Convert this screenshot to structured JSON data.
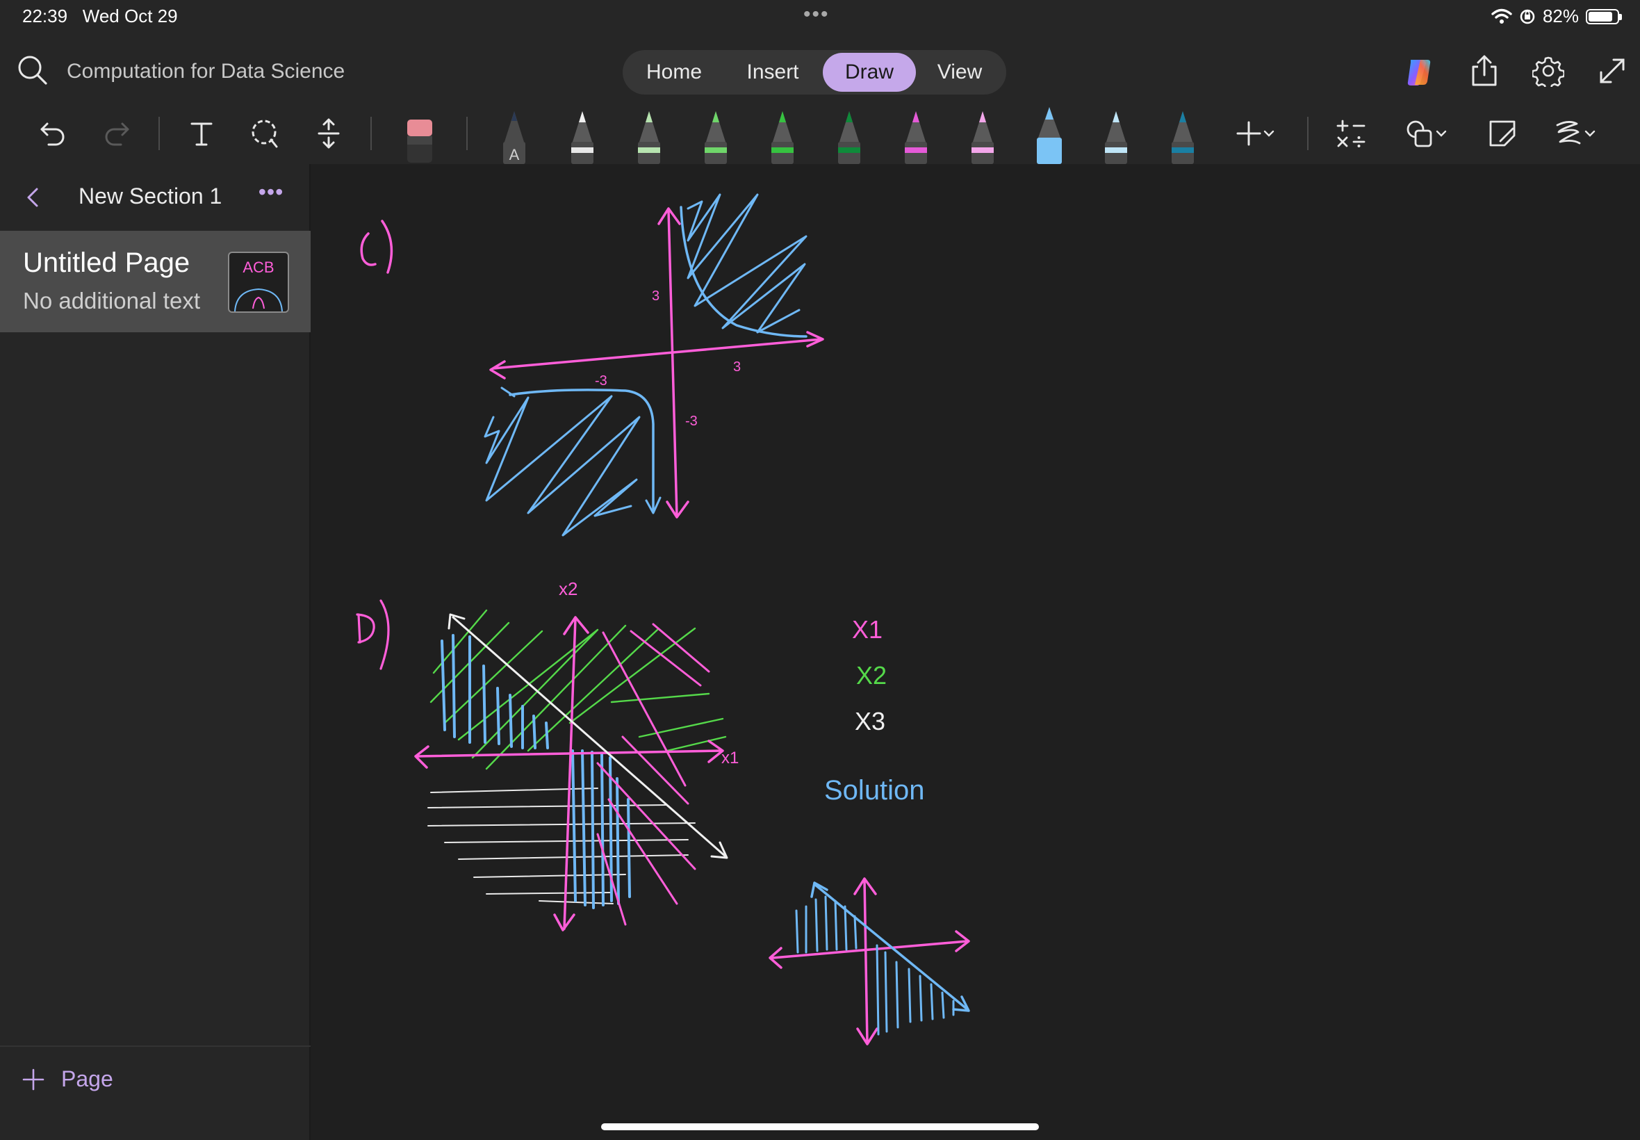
{
  "status": {
    "time": "22:39",
    "date": "Wed Oct 29",
    "battery": "82%"
  },
  "header": {
    "notebook_title": "Computation for Data Science",
    "tabs": [
      {
        "label": "Home"
      },
      {
        "label": "Insert"
      },
      {
        "label": "Draw",
        "active": true
      },
      {
        "label": "View"
      }
    ]
  },
  "ribbon": {
    "pens": [
      {
        "tip": "#2b3a55",
        "label": "A"
      },
      {
        "tip": "#f0f0f0"
      },
      {
        "tip": "#b7e4b0"
      },
      {
        "tip": "#6fd66a"
      },
      {
        "tip": "#36c240"
      },
      {
        "tip": "#0f8a3a"
      },
      {
        "tip": "#e55ad8"
      },
      {
        "tip": "#f3a6ea"
      },
      {
        "tip": "#7bc4f5"
      },
      {
        "tip": "#bfe5f7"
      },
      {
        "tip": "#1a7fa3"
      }
    ]
  },
  "sidebar": {
    "section_title": "New Section 1",
    "page": {
      "title": "Untitled Page",
      "subtitle": "No additional text",
      "thumb_text": "ACB"
    },
    "add_page_label": "Page"
  },
  "ink": {
    "label_c": "C)",
    "label_d": "D)",
    "x2_axis": "x2",
    "x1_axis": "x1",
    "tick_3_y": "3",
    "tick_3_x": "3",
    "tick_neg3_x": "-3",
    "tick_neg3_y": "-3",
    "legend": [
      {
        "text": "X1",
        "color": "#ff5ed9"
      },
      {
        "text": "X2",
        "color": "#55d94a"
      },
      {
        "text": "X3",
        "color": "#f0f0f0"
      }
    ],
    "solution": "Solution"
  },
  "colors": {
    "accent": "#c5a8ea",
    "ink_pink": "#ff5ed9",
    "ink_blue": "#6fb8f5",
    "ink_green": "#55d94a",
    "ink_white": "#f0f0f0"
  }
}
